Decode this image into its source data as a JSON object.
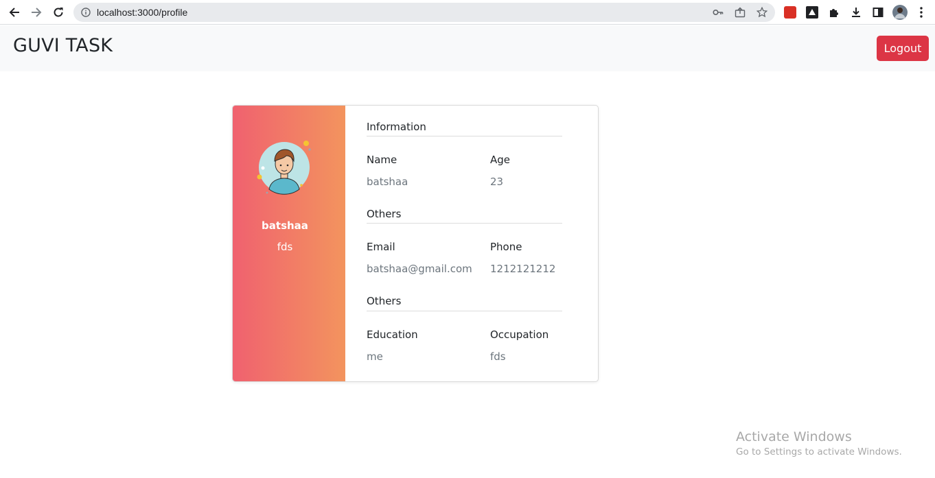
{
  "browser": {
    "url": "localhost:3000/profile",
    "icons": [
      "back-arrow-icon",
      "forward-arrow-icon",
      "reload-icon",
      "info-icon",
      "key-icon",
      "share-icon",
      "star-icon",
      "extension-icon",
      "extension-icon",
      "puzzle-icon",
      "download-icon",
      "sidebar-icon",
      "avatar",
      "kebab-menu-icon"
    ]
  },
  "navbar": {
    "brand": "GUVI TASK",
    "logout_label": "Logout",
    "logout_color": "#dc3545"
  },
  "profile": {
    "name": "batshaa",
    "subtitle": "fds",
    "gradient": [
      "#f0616f",
      "#f3945e"
    ],
    "sections": [
      {
        "title": "Information",
        "fields": [
          {
            "label": "Name",
            "value": "batshaa"
          },
          {
            "label": "Age",
            "value": "23"
          }
        ]
      },
      {
        "title": "Others",
        "fields": [
          {
            "label": "Email",
            "value": "batshaa@gmail.com"
          },
          {
            "label": "Phone",
            "value": "1212121212"
          }
        ]
      },
      {
        "title": "Others",
        "fields": [
          {
            "label": "Education",
            "value": "me"
          },
          {
            "label": "Occupation",
            "value": "fds"
          }
        ]
      }
    ]
  },
  "watermark": {
    "title": "Activate Windows",
    "subtitle": "Go to Settings to activate Windows."
  }
}
